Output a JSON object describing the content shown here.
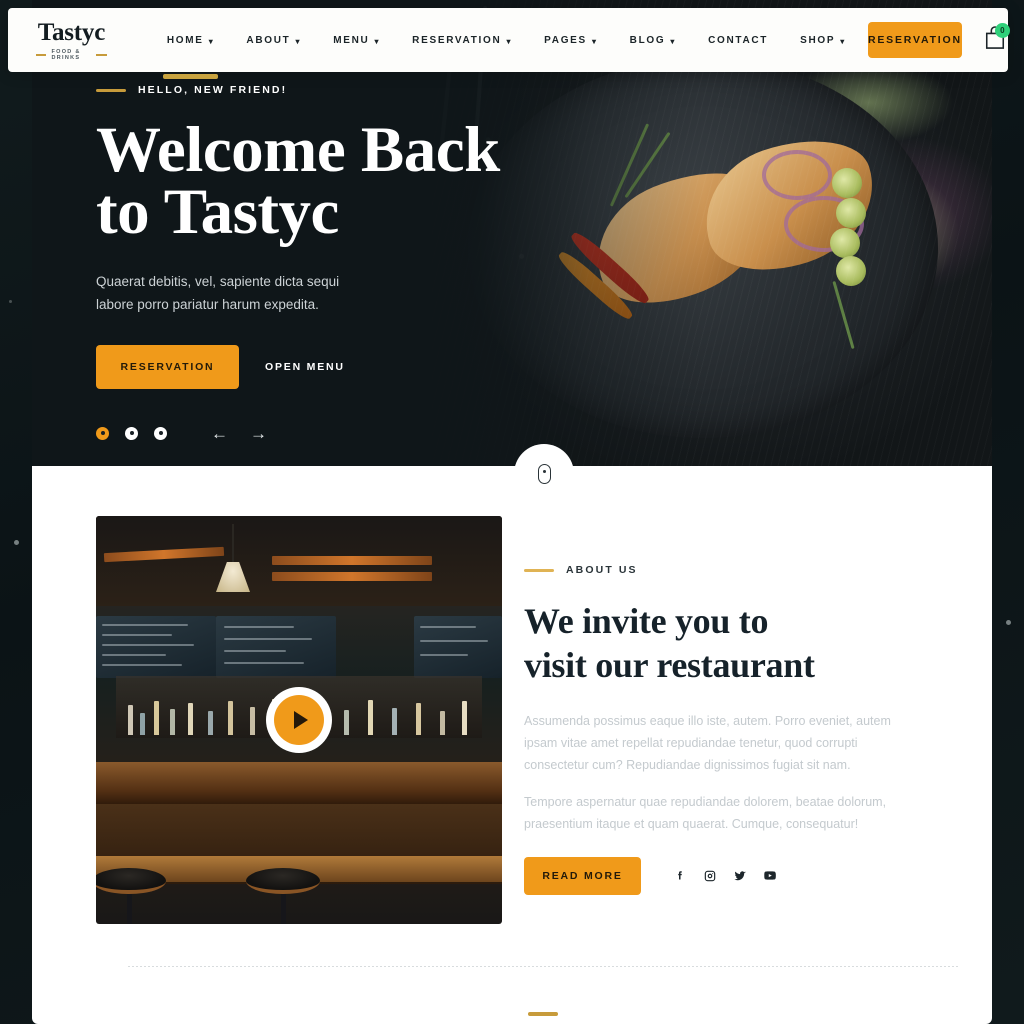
{
  "header": {
    "logo": {
      "name": "Tastyc",
      "tagline": "FOOD & DRINKS"
    },
    "nav": [
      {
        "label": "HOME",
        "caret": "chevron-down-icon",
        "active": true
      },
      {
        "label": "ABOUT",
        "caret": "chevron-down-icon",
        "active": false
      },
      {
        "label": "MENU",
        "caret": "chevron-down-icon",
        "active": false
      },
      {
        "label": "RESERVATION",
        "caret": "chevron-down-icon",
        "active": false
      },
      {
        "label": "PAGES",
        "caret": "chevron-down-icon",
        "active": false
      },
      {
        "label": "BLOG",
        "caret": "chevron-down-icon",
        "active": false
      },
      {
        "label": "CONTACT",
        "caret": "",
        "active": false
      },
      {
        "label": "SHOP",
        "caret": "chevron-down-icon",
        "active": false
      }
    ],
    "reservation_button": "RESERVATION",
    "cart": {
      "icon": "shopping-bag-icon",
      "count": "0"
    }
  },
  "hero": {
    "eyebrow": "HELLO, NEW FRIEND!",
    "title_line1": "Welcome Back",
    "title_line2": "to Tastyc",
    "paragraph": "Quaerat debitis, vel, sapiente dicta sequi labore porro pariatur harum expedita.",
    "primary_button": "RESERVATION",
    "secondary_link": "OPEN MENU",
    "dots": [
      "slide-1",
      "slide-2",
      "slide-3"
    ],
    "active_dot": 0,
    "prev_arrow": "←",
    "next_arrow": "→",
    "scroll_indicator": "mouse-scroll-icon"
  },
  "about": {
    "eyebrow": "ABOUT US",
    "title_line1": "We invite you to",
    "title_line2": "visit our restaurant",
    "paragraph1": "Assumenda possimus eaque illo iste, autem. Porro eveniet, autem ipsam vitae amet repellat repudiandae tenetur, quod corrupti consectetur cum? Repudiandae dignissimos fugiat sit nam.",
    "paragraph2": "Tempore aspernatur quae repudiandae dolorem, beatae dolorum, praesentium itaque et quam quaerat. Cumque, consequatur!",
    "read_more": "READ MORE",
    "play_button": "play-icon",
    "socials": [
      {
        "name": "facebook-icon"
      },
      {
        "name": "instagram-icon"
      },
      {
        "name": "twitter-icon"
      },
      {
        "name": "youtube-icon"
      }
    ]
  },
  "colors": {
    "accent": "#f09a1a",
    "gold": "#c79b3b",
    "dark": "#16222a",
    "badge_green": "#2fd07a",
    "page_bg": "#0d1418"
  }
}
